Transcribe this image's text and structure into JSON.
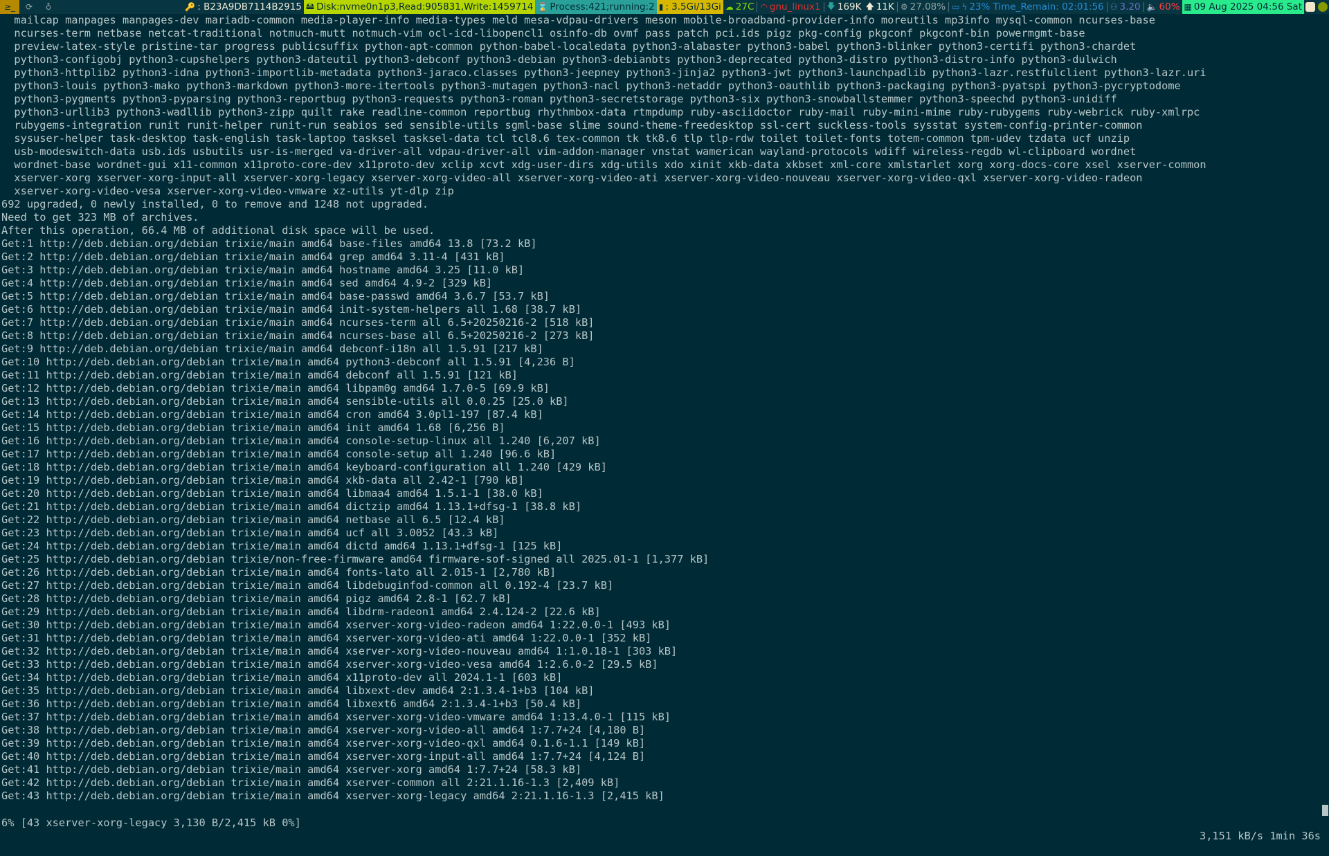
{
  "topbar": {
    "workspaces": [
      {
        "label": "≥_",
        "active": true
      },
      {
        "label": "⟳",
        "active": false
      },
      {
        "label": "♁",
        "active": false
      }
    ],
    "host": ": B23A9DB7114B2915",
    "disk": "Disk:nvme0n1p3,Read:905831,Write:1459714",
    "process": "Process:421;running:2",
    "memory": ": 3.5Gi/13Gi",
    "temperature": "27C",
    "network": "gnu_linux1",
    "download": "169K",
    "upload": "11K",
    "cpu": "27.08%",
    "battery": "23% Time_Remain: 02:01:56",
    "load": "3.20",
    "volume": "60%",
    "datetime": "09 Aug 2025 04:56 Sat"
  },
  "terminal": {
    "lines": [
      "  mailcap manpages manpages-dev mariadb-common media-player-info media-types meld mesa-vdpau-drivers meson mobile-broadband-provider-info moreutils mp3info mysql-common ncurses-base",
      "  ncurses-term netbase netcat-traditional notmuch-mutt notmuch-vim ocl-icd-libopencl1 osinfo-db ovmf pass patch pci.ids pigz pkg-config pkgconf pkgconf-bin powermgmt-base",
      "  preview-latex-style pristine-tar progress publicsuffix python-apt-common python-babel-localedata python3-alabaster python3-babel python3-blinker python3-certifi python3-chardet",
      "  python3-configobj python3-cupshelpers python3-dateutil python3-debconf python3-debian python3-debianbts python3-deprecated python3-distro python3-distro-info python3-dulwich",
      "  python3-httplib2 python3-idna python3-importlib-metadata python3-jaraco.classes python3-jeepney python3-jinja2 python3-jwt python3-launchpadlib python3-lazr.restfulclient python3-lazr.uri",
      "  python3-louis python3-mako python3-markdown python3-more-itertools python3-mutagen python3-nacl python3-netaddr python3-oauthlib python3-packaging python3-pyatspi python3-pycryptodome",
      "  python3-pygments python3-pyparsing python3-reportbug python3-requests python3-roman python3-secretstorage python3-six python3-snowballstemmer python3-speechd python3-unidiff",
      "  python3-urllib3 python3-wadllib python3-zipp quilt rake readline-common reportbug rhythmbox-data rtmpdump ruby-asciidoctor ruby-mail ruby-mini-mime ruby-rubygems ruby-webrick ruby-xmlrpc",
      "  rubygems-integration runit runit-helper runit-run seabios sed sensible-utils sgml-base slime sound-theme-freedesktop ssl-cert suckless-tools sysstat system-config-printer-common",
      "  sysuser-helper task-desktop task-english task-laptop tasksel tasksel-data tcl tcl8.6 tex-common tk tk8.6 tlp tlp-rdw toilet toilet-fonts totem-common tpm-udev tzdata ucf unzip",
      "  usb-modeswitch-data usb.ids usbutils usr-is-merged va-driver-all vdpau-driver-all vim-addon-manager vnstat wamerican wayland-protocols wdiff wireless-regdb wl-clipboard wordnet",
      "  wordnet-base wordnet-gui x11-common x11proto-core-dev x11proto-dev xclip xcvt xdg-user-dirs xdg-utils xdo xinit xkb-data xkbset xml-core xmlstarlet xorg xorg-docs-core xsel xserver-common",
      "  xserver-xorg xserver-xorg-input-all xserver-xorg-legacy xserver-xorg-video-all xserver-xorg-video-ati xserver-xorg-video-nouveau xserver-xorg-video-qxl xserver-xorg-video-radeon",
      "  xserver-xorg-video-vesa xserver-xorg-video-vmware xz-utils yt-dlp zip",
      "692 upgraded, 0 newly installed, 0 to remove and 1248 not upgraded.",
      "Need to get 323 MB of archives.",
      "After this operation, 66.4 MB of additional disk space will be used.",
      "Get:1 http://deb.debian.org/debian trixie/main amd64 base-files amd64 13.8 [73.2 kB]",
      "Get:2 http://deb.debian.org/debian trixie/main amd64 grep amd64 3.11-4 [431 kB]",
      "Get:3 http://deb.debian.org/debian trixie/main amd64 hostname amd64 3.25 [11.0 kB]",
      "Get:4 http://deb.debian.org/debian trixie/main amd64 sed amd64 4.9-2 [329 kB]",
      "Get:5 http://deb.debian.org/debian trixie/main amd64 base-passwd amd64 3.6.7 [53.7 kB]",
      "Get:6 http://deb.debian.org/debian trixie/main amd64 init-system-helpers all 1.68 [38.7 kB]",
      "Get:7 http://deb.debian.org/debian trixie/main amd64 ncurses-term all 6.5+20250216-2 [518 kB]",
      "Get:8 http://deb.debian.org/debian trixie/main amd64 ncurses-base all 6.5+20250216-2 [273 kB]",
      "Get:9 http://deb.debian.org/debian trixie/main amd64 debconf-i18n all 1.5.91 [217 kB]",
      "Get:10 http://deb.debian.org/debian trixie/main amd64 python3-debconf all 1.5.91 [4,236 B]",
      "Get:11 http://deb.debian.org/debian trixie/main amd64 debconf all 1.5.91 [121 kB]",
      "Get:12 http://deb.debian.org/debian trixie/main amd64 libpam0g amd64 1.7.0-5 [69.9 kB]",
      "Get:13 http://deb.debian.org/debian trixie/main amd64 sensible-utils all 0.0.25 [25.0 kB]",
      "Get:14 http://deb.debian.org/debian trixie/main amd64 cron amd64 3.0pl1-197 [87.4 kB]",
      "Get:15 http://deb.debian.org/debian trixie/main amd64 init amd64 1.68 [6,256 B]",
      "Get:16 http://deb.debian.org/debian trixie/main amd64 console-setup-linux all 1.240 [6,207 kB]",
      "Get:17 http://deb.debian.org/debian trixie/main amd64 console-setup all 1.240 [96.6 kB]",
      "Get:18 http://deb.debian.org/debian trixie/main amd64 keyboard-configuration all 1.240 [429 kB]",
      "Get:19 http://deb.debian.org/debian trixie/main amd64 xkb-data all 2.42-1 [790 kB]",
      "Get:20 http://deb.debian.org/debian trixie/main amd64 libmaa4 amd64 1.5.1-1 [38.0 kB]",
      "Get:21 http://deb.debian.org/debian trixie/main amd64 dictzip amd64 1.13.1+dfsg-1 [38.8 kB]",
      "Get:22 http://deb.debian.org/debian trixie/main amd64 netbase all 6.5 [12.4 kB]",
      "Get:23 http://deb.debian.org/debian trixie/main amd64 ucf all 3.0052 [43.3 kB]",
      "Get:24 http://deb.debian.org/debian trixie/main amd64 dictd amd64 1.13.1+dfsg-1 [125 kB]",
      "Get:25 http://deb.debian.org/debian trixie/non-free-firmware amd64 firmware-sof-signed all 2025.01-1 [1,377 kB]",
      "Get:26 http://deb.debian.org/debian trixie/main amd64 fonts-lato all 2.015-1 [2,780 kB]",
      "Get:27 http://deb.debian.org/debian trixie/main amd64 libdebuginfod-common all 0.192-4 [23.7 kB]",
      "Get:28 http://deb.debian.org/debian trixie/main amd64 pigz amd64 2.8-1 [62.7 kB]",
      "Get:29 http://deb.debian.org/debian trixie/main amd64 libdrm-radeon1 amd64 2.4.124-2 [22.6 kB]",
      "Get:30 http://deb.debian.org/debian trixie/main amd64 xserver-xorg-video-radeon amd64 1:22.0.0-1 [493 kB]",
      "Get:31 http://deb.debian.org/debian trixie/main amd64 xserver-xorg-video-ati amd64 1:22.0.0-1 [352 kB]",
      "Get:32 http://deb.debian.org/debian trixie/main amd64 xserver-xorg-video-nouveau amd64 1:1.0.18-1 [303 kB]",
      "Get:33 http://deb.debian.org/debian trixie/main amd64 xserver-xorg-video-vesa amd64 1:2.6.0-2 [29.5 kB]",
      "Get:34 http://deb.debian.org/debian trixie/main amd64 x11proto-dev all 2024.1-1 [603 kB]",
      "Get:35 http://deb.debian.org/debian trixie/main amd64 libxext-dev amd64 2:1.3.4-1+b3 [104 kB]",
      "Get:36 http://deb.debian.org/debian trixie/main amd64 libxext6 amd64 2:1.3.4-1+b3 [50.4 kB]",
      "Get:37 http://deb.debian.org/debian trixie/main amd64 xserver-xorg-video-vmware amd64 1:13.4.0-1 [115 kB]",
      "Get:38 http://deb.debian.org/debian trixie/main amd64 xserver-xorg-video-all amd64 1:7.7+24 [4,180 B]",
      "Get:39 http://deb.debian.org/debian trixie/main amd64 xserver-xorg-video-qxl amd64 0.1.6-1.1 [149 kB]",
      "Get:40 http://deb.debian.org/debian trixie/main amd64 xserver-xorg-input-all amd64 1:7.7+24 [4,124 B]",
      "Get:41 http://deb.debian.org/debian trixie/main amd64 xserver-xorg amd64 1:7.7+24 [58.3 kB]",
      "Get:42 http://deb.debian.org/debian trixie/main amd64 xserver-common all 2:21.1.16-1.3 [2,409 kB]",
      "Get:43 http://deb.debian.org/debian trixie/main amd64 xserver-xorg-legacy amd64 2:21.1.16-1.3 [2,415 kB]"
    ],
    "progress_left": "6% [43 xserver-xorg-legacy 3,130 B/2,415 kB 0%]",
    "progress_right": "3,151 kB/s 1min 36s"
  },
  "colors": {
    "background": "#002b36",
    "foreground": "#b8c5c7",
    "bar_background": "#073642"
  }
}
